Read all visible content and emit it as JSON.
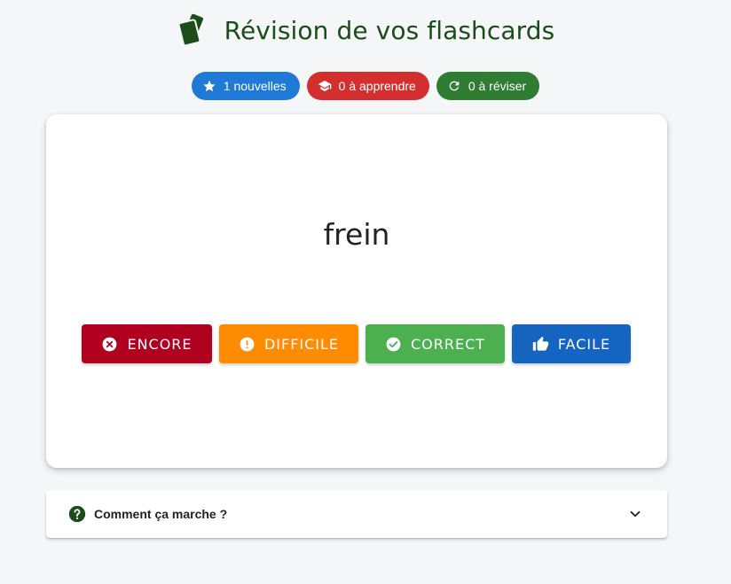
{
  "header": {
    "title": "Révision de vos flashcards",
    "icon": "cards-icon",
    "icon_color": "#1b4d1b"
  },
  "badges": {
    "new": {
      "label": "1 nouvelles",
      "icon": "star-icon",
      "color": "#1e7ad6"
    },
    "learn": {
      "label": "0 à apprendre",
      "icon": "graduation-cap-icon",
      "color": "#d32f2f"
    },
    "review": {
      "label": "0 à réviser",
      "icon": "refresh-icon",
      "color": "#2e7d32"
    }
  },
  "card": {
    "word": "frein"
  },
  "answers": {
    "again": {
      "label": "Encore",
      "icon": "cancel-circle-icon",
      "color": "#b00020"
    },
    "hard": {
      "label": "Difficile",
      "icon": "alert-circle-icon",
      "color": "#ff8c00"
    },
    "good": {
      "label": "Correct",
      "icon": "check-circle-icon",
      "color": "#4caf50"
    },
    "easy": {
      "label": "Facile",
      "icon": "thumb-up-icon",
      "color": "#1565c0"
    }
  },
  "help": {
    "label": "Comment ça marche ?",
    "icon": "help-circle-icon",
    "chevron": "chevron-down-icon"
  }
}
